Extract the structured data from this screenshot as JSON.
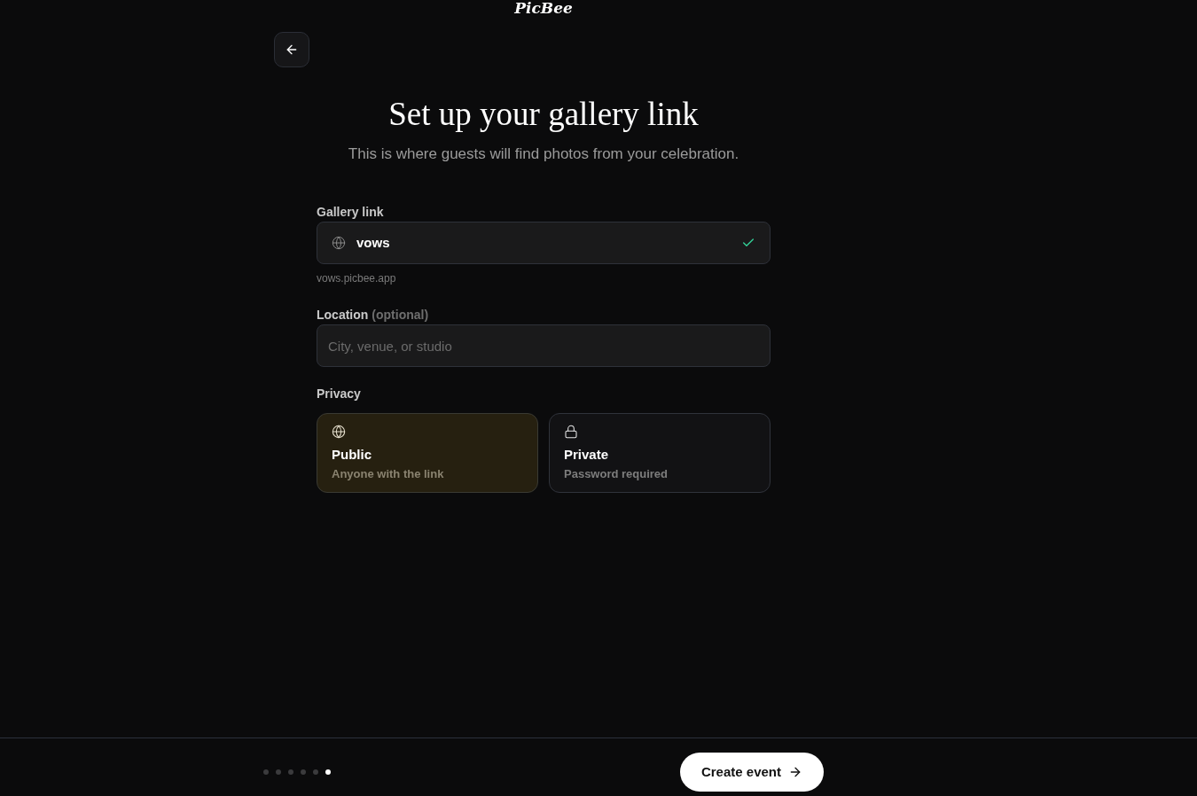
{
  "logo": {
    "text": "PicBee"
  },
  "header": {
    "title": "Set up your gallery link",
    "subtitle": "This is where guests will find photos from your celebration."
  },
  "gallery_link": {
    "label": "Gallery link",
    "value": "vows",
    "valid": true,
    "hint": "vows.picbee.app"
  },
  "location": {
    "label": "Location",
    "note": "(optional)",
    "placeholder": "City, venue, or studio"
  },
  "privacy": {
    "label": "Privacy",
    "options": [
      {
        "kind": "public",
        "title": "Public",
        "description": "Anyone with the link",
        "selected": true
      },
      {
        "kind": "private",
        "title": "Private",
        "description": "Password required",
        "selected": false
      }
    ]
  },
  "footer": {
    "steps": [
      {
        "selected": false
      },
      {
        "selected": false
      },
      {
        "selected": false
      },
      {
        "selected": false
      },
      {
        "selected": false
      },
      {
        "selected": true
      }
    ],
    "primary_button": "Create event"
  }
}
